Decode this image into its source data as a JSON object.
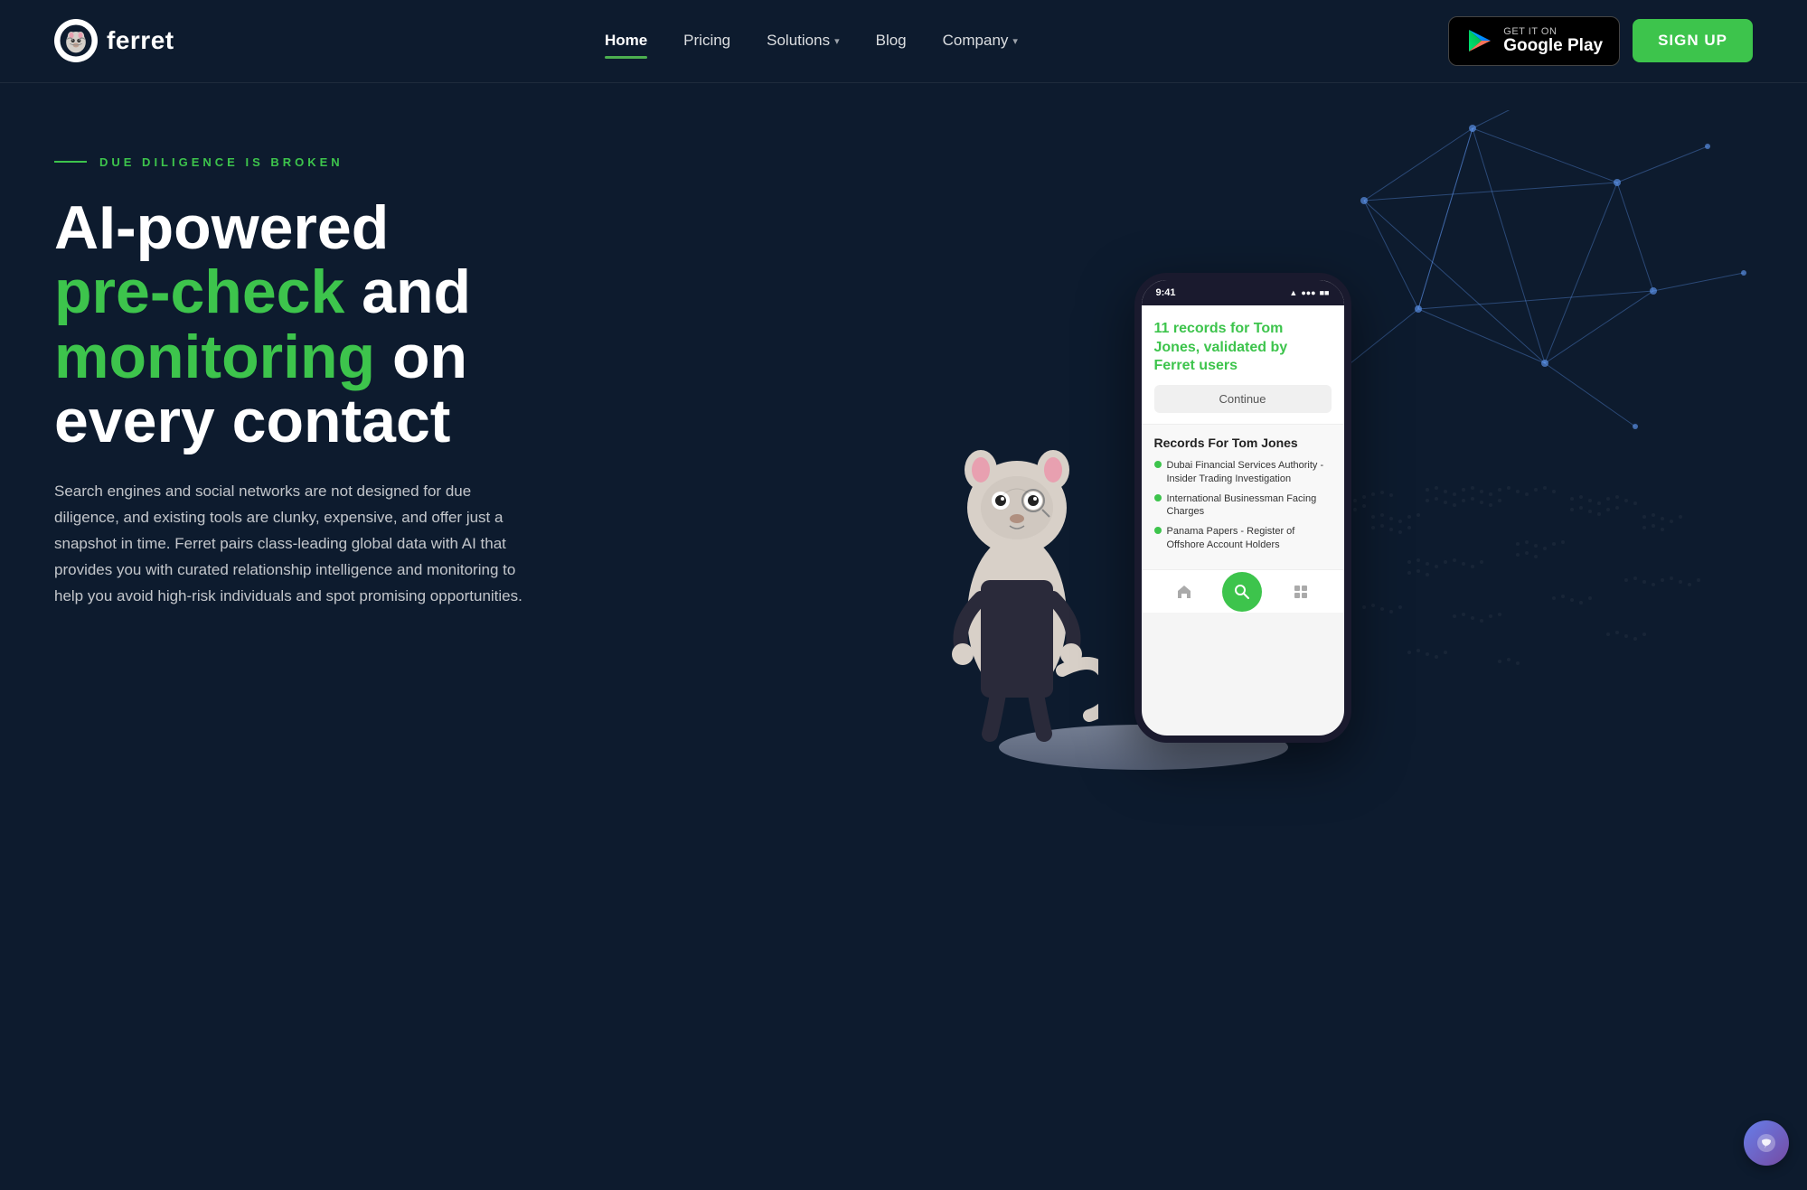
{
  "header": {
    "logo_text": "ferret",
    "nav_items": [
      {
        "label": "Home",
        "active": true
      },
      {
        "label": "Pricing",
        "active": false
      },
      {
        "label": "Solutions",
        "active": false,
        "has_dropdown": true
      },
      {
        "label": "Blog",
        "active": false
      },
      {
        "label": "Company",
        "active": false,
        "has_dropdown": true
      }
    ],
    "google_play": {
      "get_text": "GET IT ON",
      "store_text": "Google Play"
    },
    "signup_label": "SIGN UP"
  },
  "hero": {
    "subtitle": "DUE DILIGENCE IS BROKEN",
    "heading_line1": "AI-powered",
    "heading_line2_green": "pre-check",
    "heading_line2_white": " and",
    "heading_line3_green": "monitoring",
    "heading_line3_white": " on",
    "heading_line4": "every contact",
    "description": "Search engines and social networks are not designed for due diligence, and existing tools are clunky, expensive, and offer just a snapshot in time. Ferret pairs class-leading global data with AI that provides you with curated relationship intelligence and monitoring to help you avoid high-risk individuals and spot promising opportunities."
  },
  "phone": {
    "time": "9:41",
    "status_icons": [
      "●●●",
      "▲",
      "■■■"
    ],
    "top_section": {
      "count": "11",
      "records_text": " records for Tom Jones, validated by Ferret users",
      "continue_label": "Continue"
    },
    "bottom_section": {
      "title": "Records For Tom Jones",
      "records": [
        "Dubai Financial Services Authority - Insider Trading Investigation",
        "International Businessman Facing Charges",
        "Panama Papers - Register of Offshore Account Holders"
      ]
    }
  }
}
